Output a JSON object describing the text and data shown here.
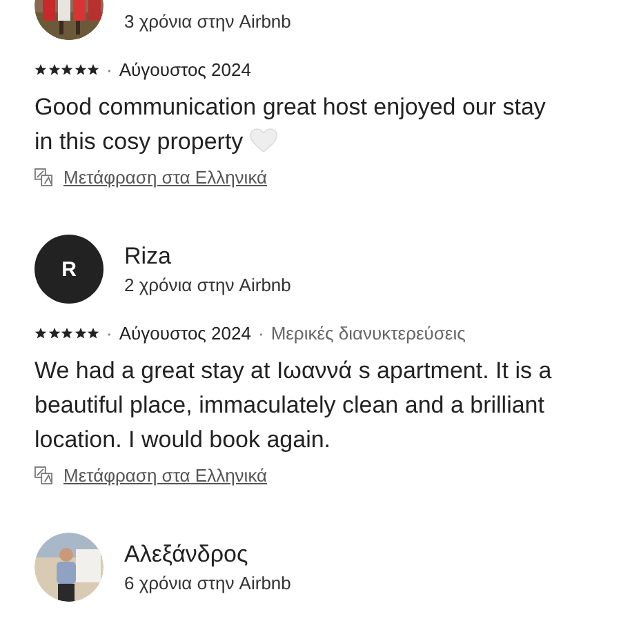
{
  "reviews": [
    {
      "tenure": "3 χρόνια στην Airbnb",
      "stars": 5,
      "separator": "·",
      "date": "Αύγουστος 2024",
      "text": "Good communication great host enjoyed our stay in this cosy property",
      "ends_with_heart": true,
      "translate_link": "Μετάφραση στα Ελληνικά"
    },
    {
      "avatar": {
        "kind": "initial",
        "initial": "R"
      },
      "name": "Riza",
      "tenure": "2 χρόνια στην Airbnb",
      "stars": 5,
      "separator": "·",
      "date": "Αύγουστος 2024",
      "stay_type": "Μερικές διανυκτερεύσεις",
      "text": "We had a great stay at Ιωαννά s apartment. It is a beautiful place, immaculately clean and a brilliant location. I would book again.",
      "ends_with_heart": false,
      "translate_link": "Μετάφραση στα Ελληνικά"
    },
    {
      "name": "Αλεξάνδρος",
      "tenure": "6 χρόνια στην Airbnb"
    }
  ]
}
